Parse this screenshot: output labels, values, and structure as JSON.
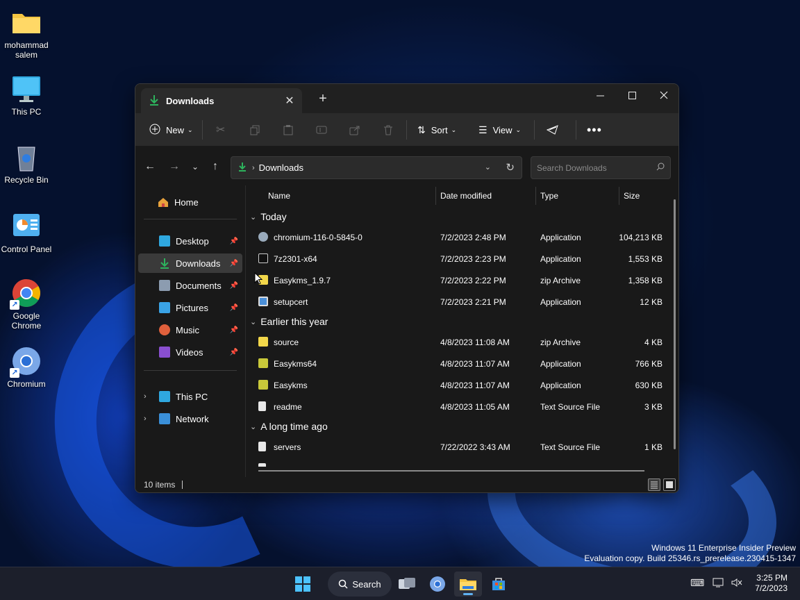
{
  "desktop": {
    "icons": [
      {
        "label": "mohammad salem",
        "icon": "folder-icon"
      },
      {
        "label": "This PC",
        "icon": "monitor-icon"
      },
      {
        "label": "Recycle Bin",
        "icon": "recycle-bin-icon"
      },
      {
        "label": "Control Panel",
        "icon": "control-panel-icon"
      },
      {
        "label": "Google Chrome",
        "icon": "chrome-icon"
      },
      {
        "label": "Chromium",
        "icon": "chromium-icon"
      }
    ]
  },
  "window": {
    "tab_title": "Downloads",
    "toolbar": {
      "new_label": "New",
      "sort_label": "Sort",
      "view_label": "View"
    },
    "address": {
      "path": "Downloads",
      "search_placeholder": "Search Downloads"
    },
    "nav": {
      "home": "Home",
      "quick_access": [
        "Desktop",
        "Downloads",
        "Documents",
        "Pictures",
        "Music",
        "Videos"
      ],
      "this_pc": "This PC",
      "network": "Network"
    },
    "columns": [
      "Name",
      "Date modified",
      "Type",
      "Size"
    ],
    "groups": [
      {
        "label": "Today",
        "files": [
          {
            "name": "chromium-116-0-5845-0",
            "date": "7/2/2023 2:48 PM",
            "type": "Application",
            "size": "104,213 KB"
          },
          {
            "name": "7z2301-x64",
            "date": "7/2/2023 2:23 PM",
            "type": "Application",
            "size": "1,553 KB"
          },
          {
            "name": "Easykms_1.9.7",
            "date": "7/2/2023 2:22 PM",
            "type": "zip Archive",
            "size": "1,358 KB"
          },
          {
            "name": "setupcert",
            "date": "7/2/2023 2:21 PM",
            "type": "Application",
            "size": "12 KB"
          }
        ]
      },
      {
        "label": "Earlier this year",
        "files": [
          {
            "name": "source",
            "date": "4/8/2023 11:08 AM",
            "type": "zip Archive",
            "size": "4 KB"
          },
          {
            "name": "Easykms64",
            "date": "4/8/2023 11:07 AM",
            "type": "Application",
            "size": "766 KB"
          },
          {
            "name": "Easykms",
            "date": "4/8/2023 11:07 AM",
            "type": "Application",
            "size": "630 KB"
          },
          {
            "name": "readme",
            "date": "4/8/2023 11:05 AM",
            "type": "Text Source File",
            "size": "3 KB"
          }
        ]
      },
      {
        "label": "A long time ago",
        "files": [
          {
            "name": "servers",
            "date": "7/22/2022 3:43 AM",
            "type": "Text Source File",
            "size": "1 KB"
          }
        ]
      }
    ],
    "status": "10 items"
  },
  "watermark": {
    "line1": "Windows 11 Enterprise Insider Preview",
    "line2": "Evaluation copy. Build 25346.rs_prerelease.230415-1347"
  },
  "taskbar": {
    "search_label": "Search",
    "time": "3:25 PM",
    "date": "7/2/2023"
  },
  "colors": {
    "accent": "#5fb2f2",
    "download_green": "#2db35d",
    "window_bg": "#191919",
    "toolbar_bg": "#2b2b2b"
  }
}
